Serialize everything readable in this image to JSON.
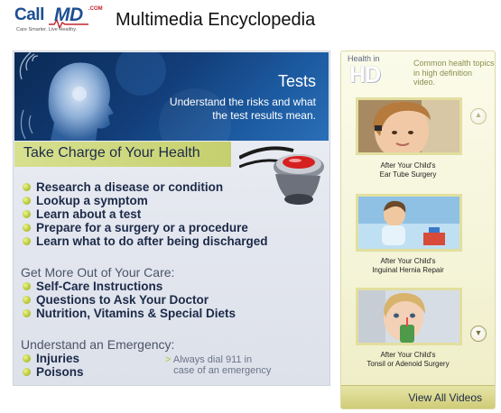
{
  "header": {
    "logo_call": "Call",
    "logo_md": "MD",
    "logo_com": ".COM",
    "logo_tagline": "Care Smarter. Live Healthy.",
    "title": "Multimedia Encyclopedia"
  },
  "banner": {
    "title": "Tests",
    "subtitle": "Understand the risks and what the test results mean."
  },
  "take_charge": {
    "heading": "Take Charge of Your Health",
    "items": [
      "Research a disease or condition",
      "Lookup a symptom",
      "Learn about a test",
      "Prepare for a surgery or a procedure",
      "Learn what to do after being discharged"
    ]
  },
  "care": {
    "heading": "Get More Out of Your Care:",
    "items": [
      "Self-Care Instructions",
      "Questions to Ask Your Doctor",
      "Nutrition, Vitamins & Special Diets"
    ]
  },
  "emergency": {
    "heading": "Understand an Emergency:",
    "items": [
      "Injuries",
      "Poisons"
    ],
    "note_line1": "Always dial 911 in",
    "note_line2": "case of an emergency",
    "note_arrow": ">"
  },
  "side": {
    "hd_small": "Health in",
    "hd_big": "HD",
    "caption": "Common health topics in high definition video.",
    "videos": [
      {
        "line1": "After Your Child's",
        "line2": "Ear Tube Surgery"
      },
      {
        "line1": "After Your Child's",
        "line2": "Inguinal Hernia Repair"
      },
      {
        "line1": "After Your Child's",
        "line2": "Tonsil or Adenoid Surgery"
      }
    ],
    "arrow_up": "▲",
    "arrow_down": "▼",
    "view_all": "View All Videos"
  },
  "colors": {
    "navy": "#1b2a48",
    "brand_blue": "#1d4f91",
    "lime_accent": "#c5cf6e",
    "side_cream": "#f4f4d8"
  }
}
